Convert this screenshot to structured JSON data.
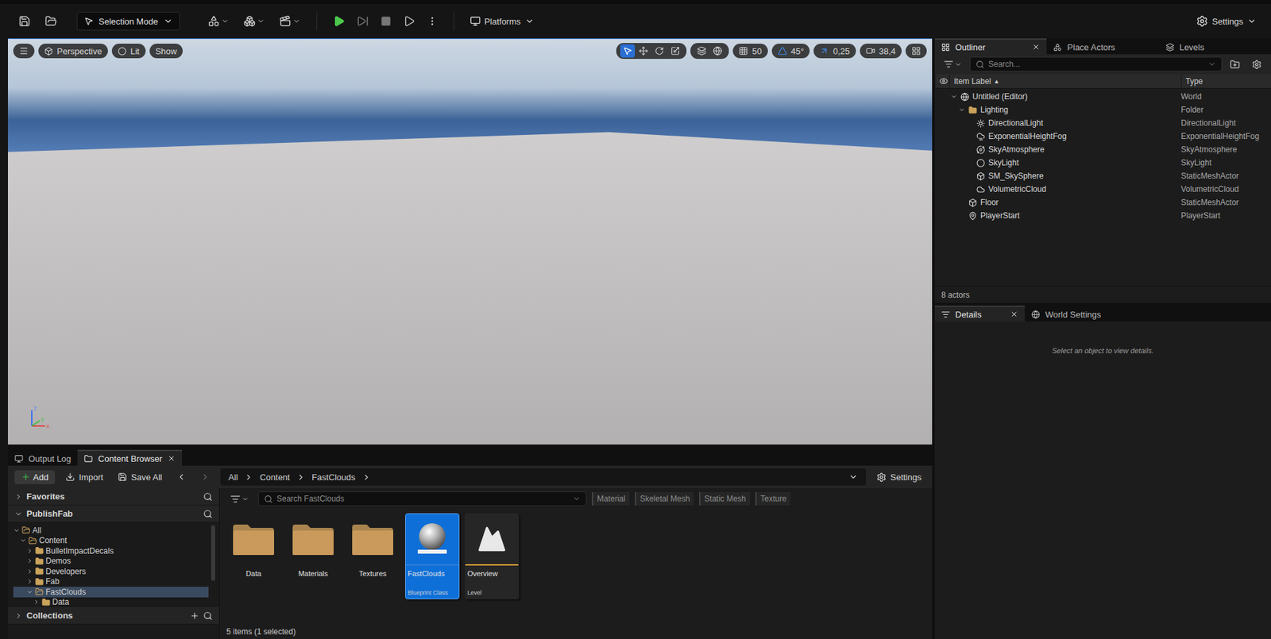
{
  "toolbar": {
    "mode": "Selection Mode",
    "platforms": "Platforms",
    "settings": "Settings"
  },
  "viewport": {
    "view": "Perspective",
    "lighting": "Lit",
    "show": "Show",
    "transform_tools": [
      {
        "selected": true
      },
      {
        "selected": false
      },
      {
        "selected": false
      },
      {
        "selected": false
      }
    ],
    "snaps": [
      {
        "value": "50",
        "on": false
      },
      {
        "value": "45°",
        "on": true
      },
      {
        "value": "0,25",
        "on": true
      }
    ],
    "camera_speed": "38,4",
    "axes": {
      "x": "x",
      "y": "y",
      "z": "z"
    }
  },
  "outliner": {
    "tabs": [
      {
        "label": "Outliner",
        "selected": true
      },
      {
        "label": "Place Actors",
        "selected": false
      },
      {
        "label": "Levels",
        "selected": false
      }
    ],
    "search": "Search...",
    "columns": [
      "Item Label",
      "Type"
    ],
    "sort": "▲",
    "rows": [
      {
        "label": "Untitled (Editor)",
        "type": "World",
        "depth": 0,
        "kind": "world",
        "expanded": true
      },
      {
        "label": "Lighting",
        "type": "Folder",
        "depth": 1,
        "kind": "folder",
        "expanded": true
      },
      {
        "label": "DirectionalLight",
        "type": "DirectionalLight",
        "depth": 2,
        "kind": "actor",
        "expanded": false
      },
      {
        "label": "ExponentialHeightFog",
        "type": "ExponentialHeightFog",
        "depth": 2,
        "kind": "actor",
        "expanded": false
      },
      {
        "label": "SkyAtmosphere",
        "type": "SkyAtmosphere",
        "depth": 2,
        "kind": "actor",
        "expanded": false
      },
      {
        "label": "SkyLight",
        "type": "SkyLight",
        "depth": 2,
        "kind": "actor",
        "expanded": false
      },
      {
        "label": "SM_SkySphere",
        "type": "StaticMeshActor",
        "depth": 2,
        "kind": "actor",
        "expanded": false
      },
      {
        "label": "VolumetricCloud",
        "type": "VolumetricCloud",
        "depth": 2,
        "kind": "actor",
        "expanded": false
      },
      {
        "label": "Floor",
        "type": "StaticMeshActor",
        "depth": 1,
        "kind": "actor",
        "expanded": false
      },
      {
        "label": "PlayerStart",
        "type": "PlayerStart",
        "depth": 1,
        "kind": "actor",
        "expanded": false
      }
    ],
    "count": "8 actors"
  },
  "details": {
    "tabs": [
      {
        "label": "Details",
        "selected": true
      },
      {
        "label": "World Settings",
        "selected": false
      }
    ],
    "empty": "Select an object to view details."
  },
  "panel_tabs": [
    {
      "label": "Output Log",
      "selected": false
    },
    {
      "label": "Content Browser",
      "selected": true
    }
  ],
  "content_browser": {
    "add": "Add",
    "import": "Import",
    "save_all": "Save All",
    "path": [
      "All",
      "Content",
      "FastClouds"
    ],
    "settings": "Settings",
    "favorites": "Favorites",
    "project": "PublishFab",
    "collections": "Collections",
    "tree": [
      {
        "label": "All",
        "depth": 0,
        "expanded": true,
        "selected": false
      },
      {
        "label": "Content",
        "depth": 1,
        "expanded": true,
        "selected": false
      },
      {
        "label": "BulletImpactDecals",
        "depth": 2,
        "expanded": false,
        "selected": false
      },
      {
        "label": "Demos",
        "depth": 2,
        "expanded": false,
        "selected": false
      },
      {
        "label": "Developers",
        "depth": 2,
        "expanded": false,
        "selected": false
      },
      {
        "label": "Fab",
        "depth": 2,
        "expanded": false,
        "selected": false
      },
      {
        "label": "FastClouds",
        "depth": 2,
        "expanded": true,
        "selected": true
      },
      {
        "label": "Data",
        "depth": 3,
        "expanded": false,
        "selected": false
      }
    ],
    "search": "Search FastClouds",
    "filters": [
      "Material",
      "Skeletal Mesh",
      "Static Mesh",
      "Texture"
    ],
    "items": [
      {
        "name": "Data",
        "kind": "folder",
        "selected": false
      },
      {
        "name": "Materials",
        "kind": "folder",
        "selected": false
      },
      {
        "name": "Textures",
        "kind": "folder",
        "selected": false
      },
      {
        "name": "FastClouds",
        "kind": "blueprint",
        "type": "Blueprint Class",
        "color": "#2f7fd8",
        "selected": true
      },
      {
        "name": "Overview",
        "kind": "level",
        "type": "Level",
        "color": "#e0a238",
        "selected": false
      }
    ],
    "status": "5 items (1 selected)"
  }
}
